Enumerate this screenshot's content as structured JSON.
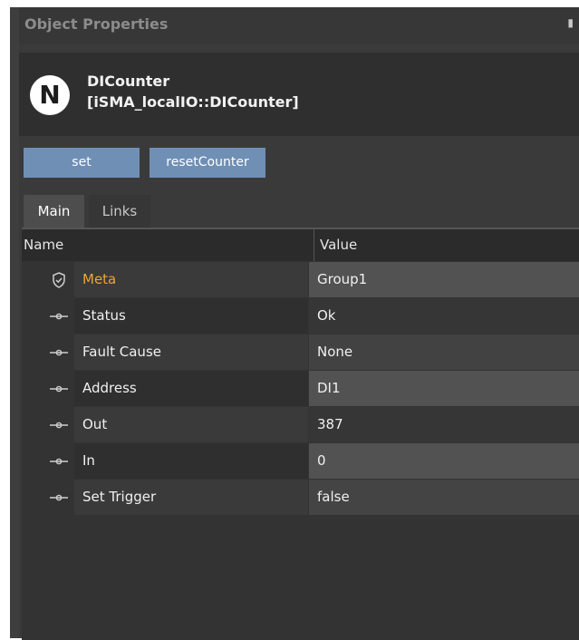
{
  "panel": {
    "title": "Object Properties",
    "pin_icon": "pin-icon"
  },
  "object": {
    "icon_letter": "N",
    "name": "DICounter",
    "type": "[iSMA_localIO::DICounter]"
  },
  "actions": {
    "set_label": "set",
    "reset_label": "resetCounter"
  },
  "tabs": [
    {
      "label": "Main",
      "active": true
    },
    {
      "label": "Links",
      "active": false
    }
  ],
  "table": {
    "headers": {
      "name": "Name",
      "value": "Value"
    },
    "rows": [
      {
        "name": "Meta",
        "value": "Group1",
        "icon": "shield-icon"
      },
      {
        "name": "Status",
        "value": "Ok",
        "icon": "slot-icon"
      },
      {
        "name": "Fault Cause",
        "value": "None",
        "icon": "slot-icon"
      },
      {
        "name": "Address",
        "value": "DI1",
        "icon": "slot-icon"
      },
      {
        "name": "Out",
        "value": "387",
        "icon": "slot-icon"
      },
      {
        "name": "In",
        "value": "0",
        "icon": "slot-icon"
      },
      {
        "name": "Set Trigger",
        "value": "false",
        "icon": "slot-icon"
      }
    ]
  },
  "colors": {
    "meta_label": "#f1a431",
    "button_bg": "#6f8fb5"
  }
}
